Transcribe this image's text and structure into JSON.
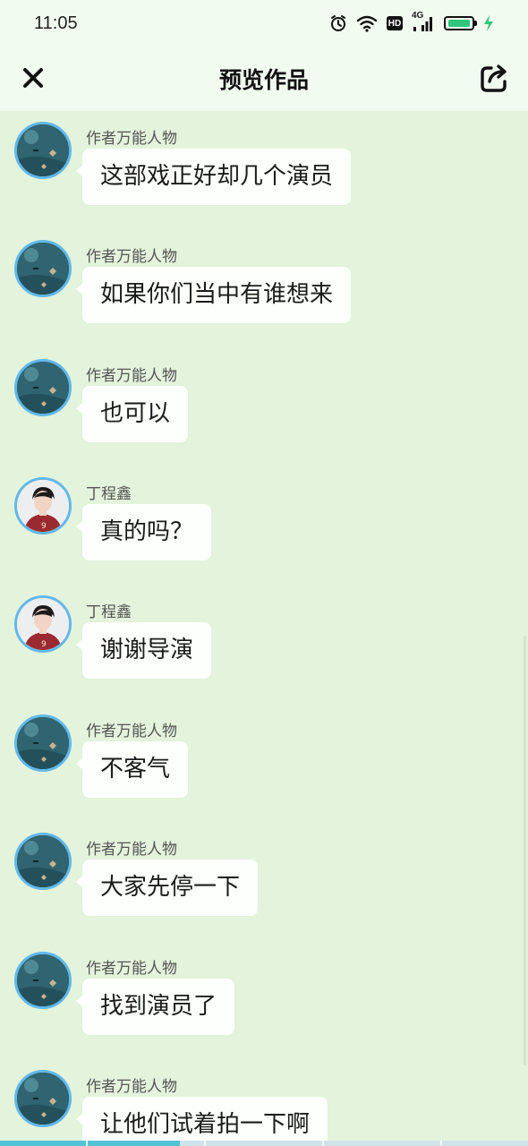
{
  "status_bar": {
    "time": "11:05",
    "hd_label": "HD",
    "network_label": "4G",
    "battery_level": 0.9,
    "icons": [
      "alarm-icon",
      "wifi-icon",
      "hd-icon",
      "signal-icon",
      "battery-icon",
      "charging-icon"
    ]
  },
  "nav": {
    "title": "预览作品",
    "close_icon": "close-icon",
    "share_icon": "share-icon"
  },
  "messages": [
    {
      "sender": "作者万能人物",
      "text": "这部戏正好却几个演员",
      "avatar": "author"
    },
    {
      "sender": "作者万能人物",
      "text": "如果你们当中有谁想来",
      "avatar": "author"
    },
    {
      "sender": "作者万能人物",
      "text": "也可以",
      "avatar": "author"
    },
    {
      "sender": "丁程鑫",
      "text": "真的吗？",
      "avatar": "person"
    },
    {
      "sender": "丁程鑫",
      "text": "谢谢导演",
      "avatar": "person"
    },
    {
      "sender": "作者万能人物",
      "text": "不客气",
      "avatar": "author"
    },
    {
      "sender": "作者万能人物",
      "text": "大家先停一下",
      "avatar": "author"
    },
    {
      "sender": "作者万能人物",
      "text": "找到演员了",
      "avatar": "author"
    },
    {
      "sender": "作者万能人物",
      "text": "让他们试着拍一下啊",
      "avatar": "author"
    }
  ],
  "progress": {
    "fraction": 0.34
  },
  "colors": {
    "background": "#e3f3dc",
    "header": "#f1fbef",
    "bubble": "#fcfffb",
    "avatar_ring": "#62b8ea",
    "progress": "#52c2d6"
  }
}
